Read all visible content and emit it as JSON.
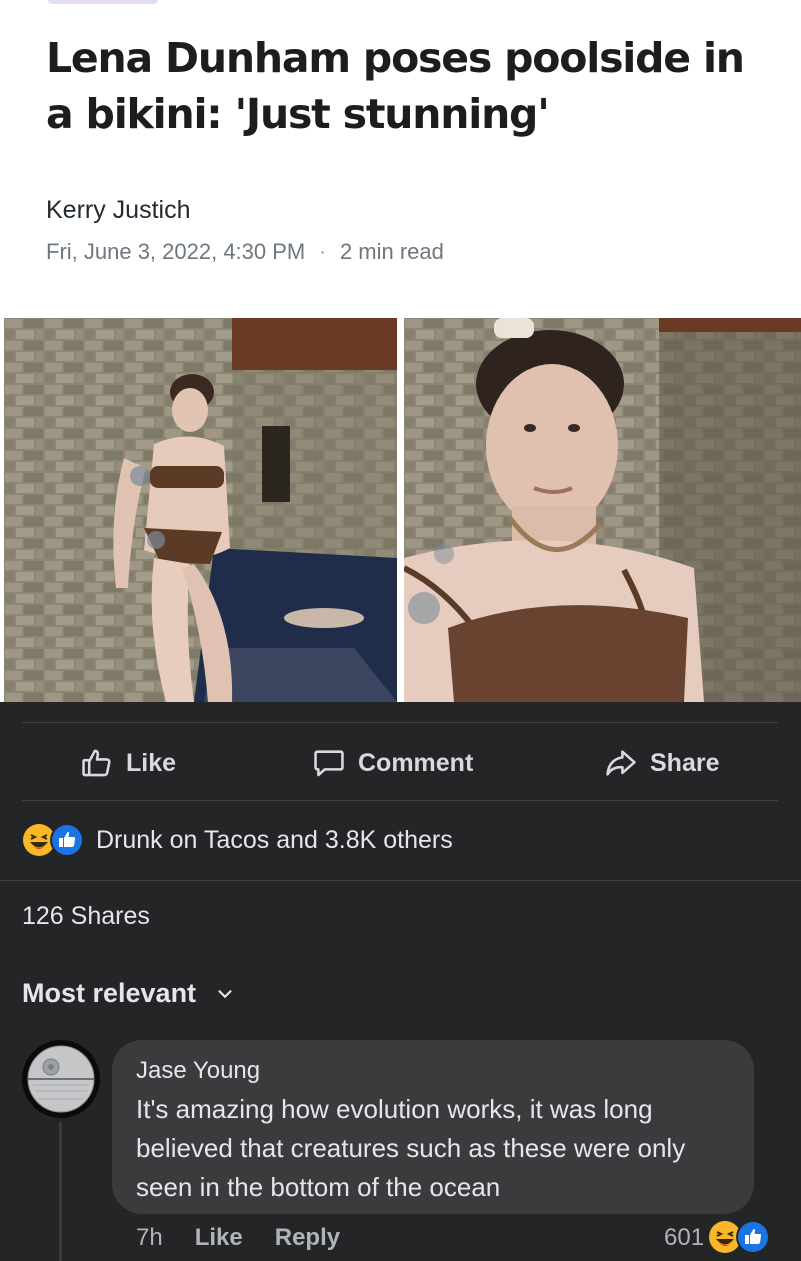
{
  "article": {
    "headline": "Lena Dunham poses poolside in a bikini: 'Just stunning'",
    "author": "Kerry Justich",
    "date": "Fri, June 3, 2022, 4:30 PM",
    "separator": "·",
    "read_time": "2 min read"
  },
  "post": {
    "actions": {
      "like": "Like",
      "comment": "Comment",
      "share": "Share"
    },
    "reactions_summary": "Drunk on Tacos and 3.8K others",
    "shares": "126 Shares",
    "sort_label": "Most relevant"
  },
  "comment": {
    "author": "Jase Young",
    "text": "It's amazing how evolution works, it was long believed that creatures such as these were only seen in the bottom of the ocean",
    "time": "7h",
    "like": "Like",
    "reply": "Reply",
    "reaction_count": "601"
  },
  "colors": {
    "fb_background": "#242526",
    "bubble": "#3a3b3c",
    "like_blue": "#1b74e4",
    "haha_yellow": "#f7b928"
  },
  "icons": [
    "thumbs-up-outline-icon",
    "comment-bubble-icon",
    "share-arrow-icon",
    "haha-reaction-icon",
    "like-reaction-icon",
    "chevron-down-icon"
  ]
}
